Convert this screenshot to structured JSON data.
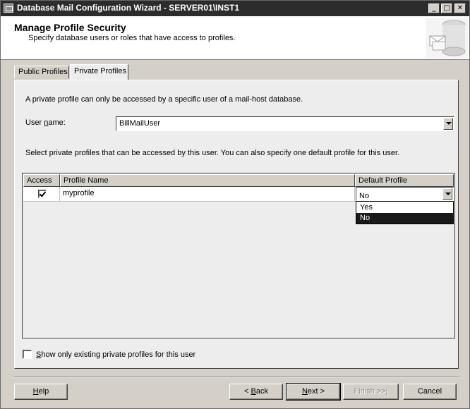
{
  "window": {
    "title": "Database Mail Configuration Wizard - SERVER01\\INST1",
    "controls": [
      "_",
      "□",
      "✕"
    ]
  },
  "header": {
    "title": "Manage Profile Security",
    "subtitle": "Specify database users or roles that have access to profiles."
  },
  "tabs": [
    {
      "label": "Public Profiles",
      "active": false
    },
    {
      "label": "Private Profiles",
      "active": true
    }
  ],
  "panel": {
    "intro": "A private profile can only be accessed by a specific user of a mail-host database.",
    "user_name_label": "User name:",
    "user_name_value": "BillMailUser",
    "instruction": "Select private profiles that can be accessed by this user. You can also specify one default profile for this user."
  },
  "grid": {
    "columns": [
      "Access",
      "Profile Name",
      "Default Profile"
    ],
    "rows": [
      {
        "access": true,
        "profile_name": "myprofile",
        "default_profile": "No"
      }
    ],
    "dropdown_options": [
      "Yes",
      "No"
    ],
    "dropdown_selected": "No"
  },
  "show_existing": {
    "label": "Show only existing private profiles for this user",
    "checked": false
  },
  "buttons": {
    "help": "Help",
    "back": "< Back",
    "next": "Next >",
    "finish": "Finish >>|",
    "cancel": "Cancel"
  }
}
